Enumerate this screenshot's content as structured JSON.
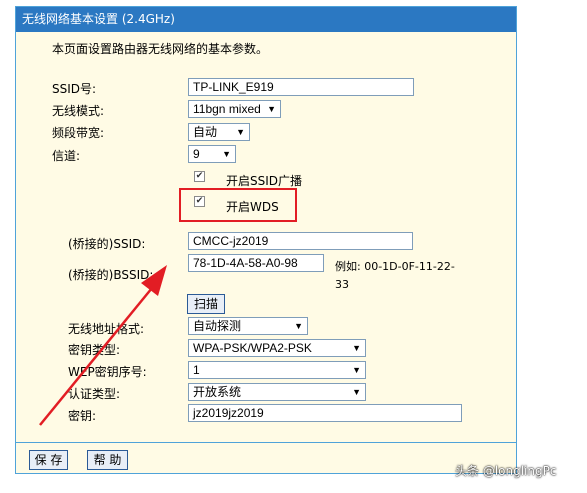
{
  "title": "无线网络基本设置 (2.4GHz)",
  "description": "本页面设置路由器无线网络的基本参数。",
  "fields": {
    "ssid": {
      "label": "SSID号:",
      "value": "TP-LINK_E919"
    },
    "mode": {
      "label": "无线模式:",
      "value": "11bgn mixed"
    },
    "bandwidth": {
      "label": "频段带宽:",
      "value": "自动"
    },
    "channel": {
      "label": "信道:",
      "value": "9"
    },
    "ssid_broadcast": {
      "label": "开启SSID广播",
      "checked": true
    },
    "wds": {
      "label": "开启WDS",
      "checked": true
    },
    "bridged_ssid": {
      "label": "(桥接的)SSID:",
      "value": "CMCC-jz2019"
    },
    "bridged_bssid": {
      "label": "(桥接的)BSSID:",
      "value": "78-1D-4A-58-A0-98",
      "example": "例如: 00-1D-0F-11-22-33"
    },
    "scan_button": "扫描",
    "key_format": {
      "label": "无线地址格式:",
      "value": "自动探测"
    },
    "key_type": {
      "label": "密钥类型:",
      "value": "WPA-PSK/WPA2-PSK"
    },
    "wep_index": {
      "label": "WEP密钥序号:",
      "value": "1"
    },
    "auth_type": {
      "label": "认证类型:",
      "value": "开放系统"
    },
    "key": {
      "label": "密钥:",
      "value": "jz2019jz2019"
    }
  },
  "buttons": {
    "save": "保 存",
    "help": "帮 助"
  },
  "watermark": "头条 @longlingPc",
  "colors": {
    "titlebar": "#2b78c2",
    "panel_bg": "#fffbe5",
    "highlight": "#e21d24",
    "arrow": "#e21d24"
  }
}
